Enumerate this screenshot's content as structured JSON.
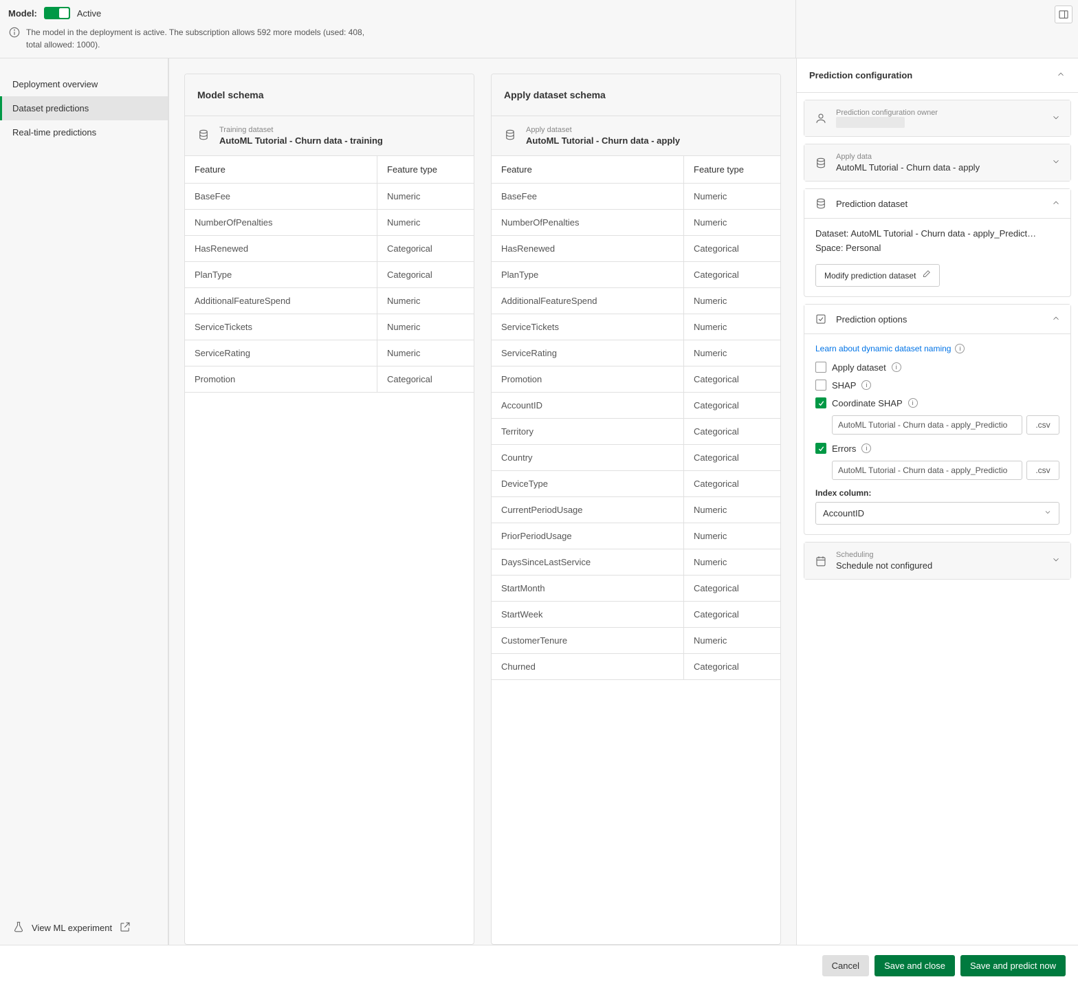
{
  "header": {
    "model_label": "Model:",
    "active_text": "Active",
    "info_text": "The model in the deployment is active. The subscription allows 592 more models (used: 408, total allowed: 1000)."
  },
  "sidebar": {
    "items": [
      {
        "label": "Deployment overview",
        "active": false
      },
      {
        "label": "Dataset predictions",
        "active": true
      },
      {
        "label": "Real-time predictions",
        "active": false
      }
    ],
    "footer_label": "View ML experiment"
  },
  "model_schema": {
    "title": "Model schema",
    "ds_label": "Training dataset",
    "ds_name": "AutoML Tutorial - Churn data - training",
    "col_feature": "Feature",
    "col_type": "Feature type",
    "rows": [
      {
        "feature": "BaseFee",
        "type": "Numeric"
      },
      {
        "feature": "NumberOfPenalties",
        "type": "Numeric"
      },
      {
        "feature": "HasRenewed",
        "type": "Categorical"
      },
      {
        "feature": "PlanType",
        "type": "Categorical"
      },
      {
        "feature": "AdditionalFeatureSpend",
        "type": "Numeric"
      },
      {
        "feature": "ServiceTickets",
        "type": "Numeric"
      },
      {
        "feature": "ServiceRating",
        "type": "Numeric"
      },
      {
        "feature": "Promotion",
        "type": "Categorical"
      }
    ]
  },
  "apply_schema": {
    "title": "Apply dataset schema",
    "ds_label": "Apply dataset",
    "ds_name": "AutoML Tutorial - Churn data - apply",
    "col_feature": "Feature",
    "col_type": "Feature type",
    "rows": [
      {
        "feature": "BaseFee",
        "type": "Numeric"
      },
      {
        "feature": "NumberOfPenalties",
        "type": "Numeric"
      },
      {
        "feature": "HasRenewed",
        "type": "Categorical"
      },
      {
        "feature": "PlanType",
        "type": "Categorical"
      },
      {
        "feature": "AdditionalFeatureSpend",
        "type": "Numeric"
      },
      {
        "feature": "ServiceTickets",
        "type": "Numeric"
      },
      {
        "feature": "ServiceRating",
        "type": "Numeric"
      },
      {
        "feature": "Promotion",
        "type": "Categorical"
      },
      {
        "feature": "AccountID",
        "type": "Categorical"
      },
      {
        "feature": "Territory",
        "type": "Categorical"
      },
      {
        "feature": "Country",
        "type": "Categorical"
      },
      {
        "feature": "DeviceType",
        "type": "Categorical"
      },
      {
        "feature": "CurrentPeriodUsage",
        "type": "Numeric"
      },
      {
        "feature": "PriorPeriodUsage",
        "type": "Numeric"
      },
      {
        "feature": "DaysSinceLastService",
        "type": "Numeric"
      },
      {
        "feature": "StartMonth",
        "type": "Categorical"
      },
      {
        "feature": "StartWeek",
        "type": "Categorical"
      },
      {
        "feature": "CustomerTenure",
        "type": "Numeric"
      },
      {
        "feature": "Churned",
        "type": "Categorical"
      }
    ]
  },
  "right": {
    "title": "Prediction configuration",
    "owner_label": "Prediction configuration owner",
    "apply_label": "Apply data",
    "apply_value": "AutoML Tutorial - Churn data - apply",
    "pred_ds_title": "Prediction dataset",
    "dataset_label": "Dataset:",
    "dataset_value": "AutoML Tutorial - Churn data - apply_Predict…",
    "space_label": "Space:",
    "space_value": "Personal",
    "modify_btn": "Modify prediction dataset",
    "options_title": "Prediction options",
    "learn_link": "Learn about dynamic dataset naming",
    "opt_apply_dataset": "Apply dataset",
    "opt_shap": "SHAP",
    "opt_coord_shap": "Coordinate SHAP",
    "coord_shap_input": "AutoML Tutorial - Churn data - apply_Predictio",
    "csv_ext": ".csv",
    "opt_errors": "Errors",
    "errors_input": "AutoML Tutorial - Churn data - apply_Predictio",
    "index_col_label": "Index column:",
    "index_col_value": "AccountID",
    "sched_label": "Scheduling",
    "sched_value": "Schedule not configured"
  },
  "footer": {
    "cancel": "Cancel",
    "save_close": "Save and close",
    "save_predict": "Save and predict now"
  }
}
